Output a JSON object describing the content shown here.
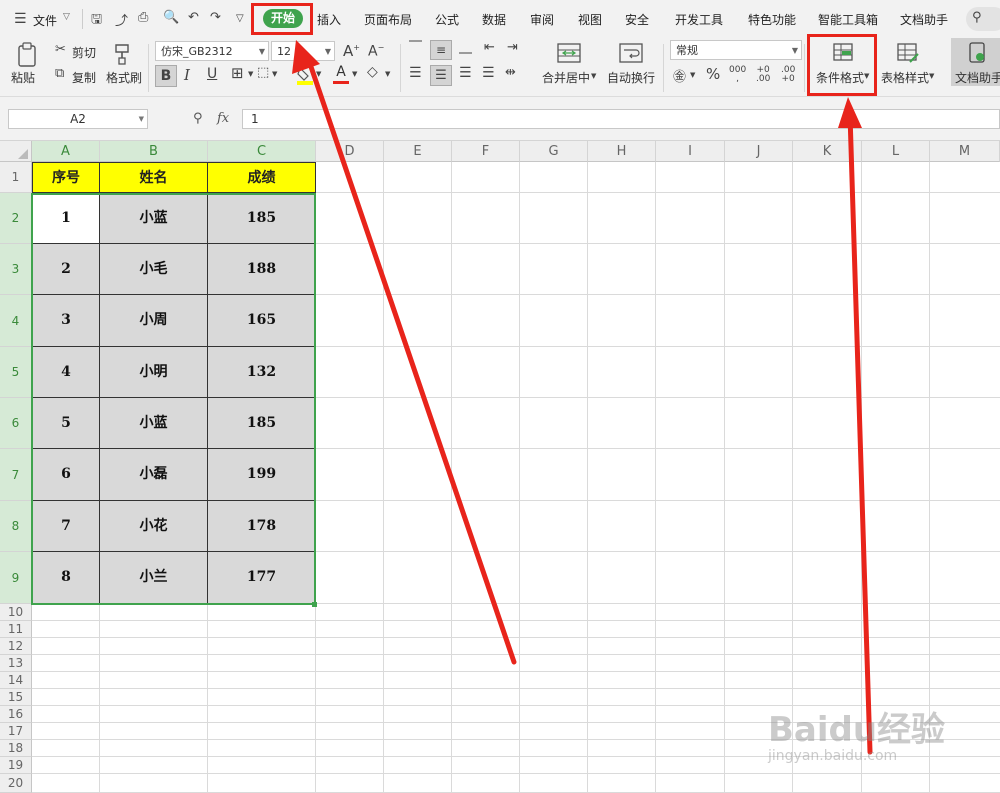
{
  "app": {
    "menu_label": "文件",
    "tabs": [
      "开始",
      "插入",
      "页面布局",
      "公式",
      "数据",
      "审阅",
      "视图",
      "安全",
      "开发工具",
      "特色功能",
      "智能工具箱",
      "文档助手"
    ],
    "active_tab": "开始"
  },
  "ribbon": {
    "paste": "粘贴",
    "cut": "剪切",
    "copy": "复制",
    "format_painter": "格式刷",
    "font_name": "仿宋_GB2312",
    "font_size": "12",
    "merge_center": "合并居中",
    "wrap_text": "自动换行",
    "number_format": "常规",
    "conditional_format": "条件格式",
    "table_style": "表格样式",
    "doc_assistant": "文档助手"
  },
  "formula_bar": {
    "name_box": "A2",
    "fx": "fx",
    "value": "1"
  },
  "columns": [
    "A",
    "B",
    "C",
    "D",
    "E",
    "F",
    "G",
    "H",
    "I",
    "J",
    "K",
    "L",
    "M"
  ],
  "rows": [
    "1",
    "2",
    "3",
    "4",
    "5",
    "6",
    "7",
    "8",
    "9",
    "10",
    "11",
    "12",
    "13",
    "14",
    "15",
    "16",
    "17",
    "18",
    "19",
    "20"
  ],
  "table": {
    "headers": [
      "序号",
      "姓名",
      "成绩"
    ],
    "rows": [
      [
        "1",
        "小蓝",
        "185"
      ],
      [
        "2",
        "小毛",
        "188"
      ],
      [
        "3",
        "小周",
        "165"
      ],
      [
        "4",
        "小明",
        "132"
      ],
      [
        "5",
        "小蓝",
        "185"
      ],
      [
        "6",
        "小磊",
        "199"
      ],
      [
        "7",
        "小花",
        "178"
      ],
      [
        "8",
        "小兰",
        "177"
      ]
    ]
  },
  "colors": {
    "accent_green": "#3fa34d",
    "header_fill": "#ffff00",
    "data_fill": "#d9d9d9",
    "annotation_red": "#e8241b"
  },
  "watermark": {
    "logo": "Baidu经验",
    "url": "jingyan.baidu.com"
  }
}
